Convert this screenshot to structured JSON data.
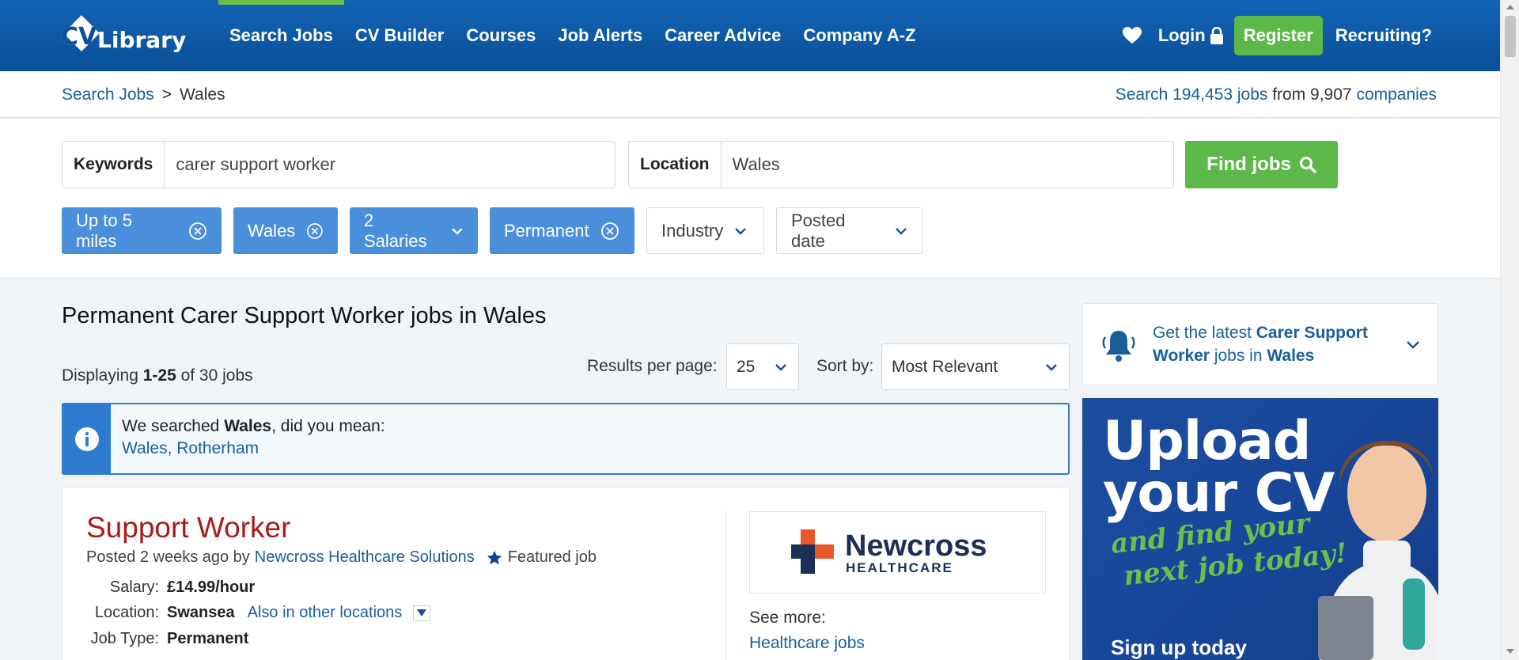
{
  "header": {
    "logo_text": "CV Library",
    "nav": [
      "Search Jobs",
      "CV Builder",
      "Courses",
      "Job Alerts",
      "Career Advice",
      "Company A-Z"
    ],
    "login": "Login",
    "register": "Register",
    "recruiting": "Recruiting?"
  },
  "breadcrumb": {
    "root": "Search Jobs",
    "sep": ">",
    "current": "Wales"
  },
  "stats": {
    "search_link": "Search 194,453 jobs",
    "from": " from 9,907 ",
    "companies": "companies"
  },
  "search": {
    "keywords_label": "Keywords",
    "keywords_value": "carer support worker",
    "location_label": "Location",
    "location_value": "Wales",
    "find_button": "Find jobs"
  },
  "filters": [
    {
      "label": "Up to 5 miles",
      "active": true
    },
    {
      "label": "Wales",
      "active": true
    },
    {
      "label": "2 Salaries",
      "active": true
    },
    {
      "label": "Permanent",
      "active": true
    },
    {
      "label": "Industry",
      "active": false
    },
    {
      "label": "Posted date",
      "active": false
    }
  ],
  "results": {
    "title": "Permanent Carer Support Worker jobs in Wales",
    "displaying_prefix": "Displaying ",
    "displaying_range": "1-25",
    "displaying_suffix": " of 30 jobs",
    "per_page_label": "Results per page:",
    "per_page_value": "25",
    "sort_label": "Sort by:",
    "sort_value": "Most Relevant"
  },
  "info": {
    "prefix": "We searched ",
    "term": "Wales",
    "suffix": ", did you mean:",
    "suggestion": "Wales, Rotherham"
  },
  "job": {
    "title": "Support Worker",
    "posted": "Posted 2 weeks ago by",
    "company": "Newcross Healthcare Solutions",
    "featured": "Featured job",
    "salary_label": "Salary:",
    "salary": "£14.99/hour",
    "location_label": "Location:",
    "location": "Swansea",
    "other_locations": "Also in other locations",
    "type_label": "Job Type:",
    "type": "Permanent",
    "logo_name": "Newcross",
    "logo_sub": "HEALTHCARE",
    "see_more": "See more:",
    "see_more_link": "Healthcare jobs"
  },
  "sidebar": {
    "alert_prefix": "Get the latest ",
    "alert_term": "Carer Support Worker",
    "alert_mid": " jobs in ",
    "alert_loc": "Wales",
    "ad_line1": "Upload",
    "ad_line2": "your CV",
    "ad_script1": "and find your",
    "ad_script2": "next job today!",
    "ad_cta": "Sign up today"
  },
  "colors": {
    "brand_blue": "#0a4f98",
    "accent_green": "#5cb848",
    "chip_blue": "#4a8fdb",
    "job_title_red": "#a91b1b",
    "link_blue": "#1a5e9c"
  }
}
